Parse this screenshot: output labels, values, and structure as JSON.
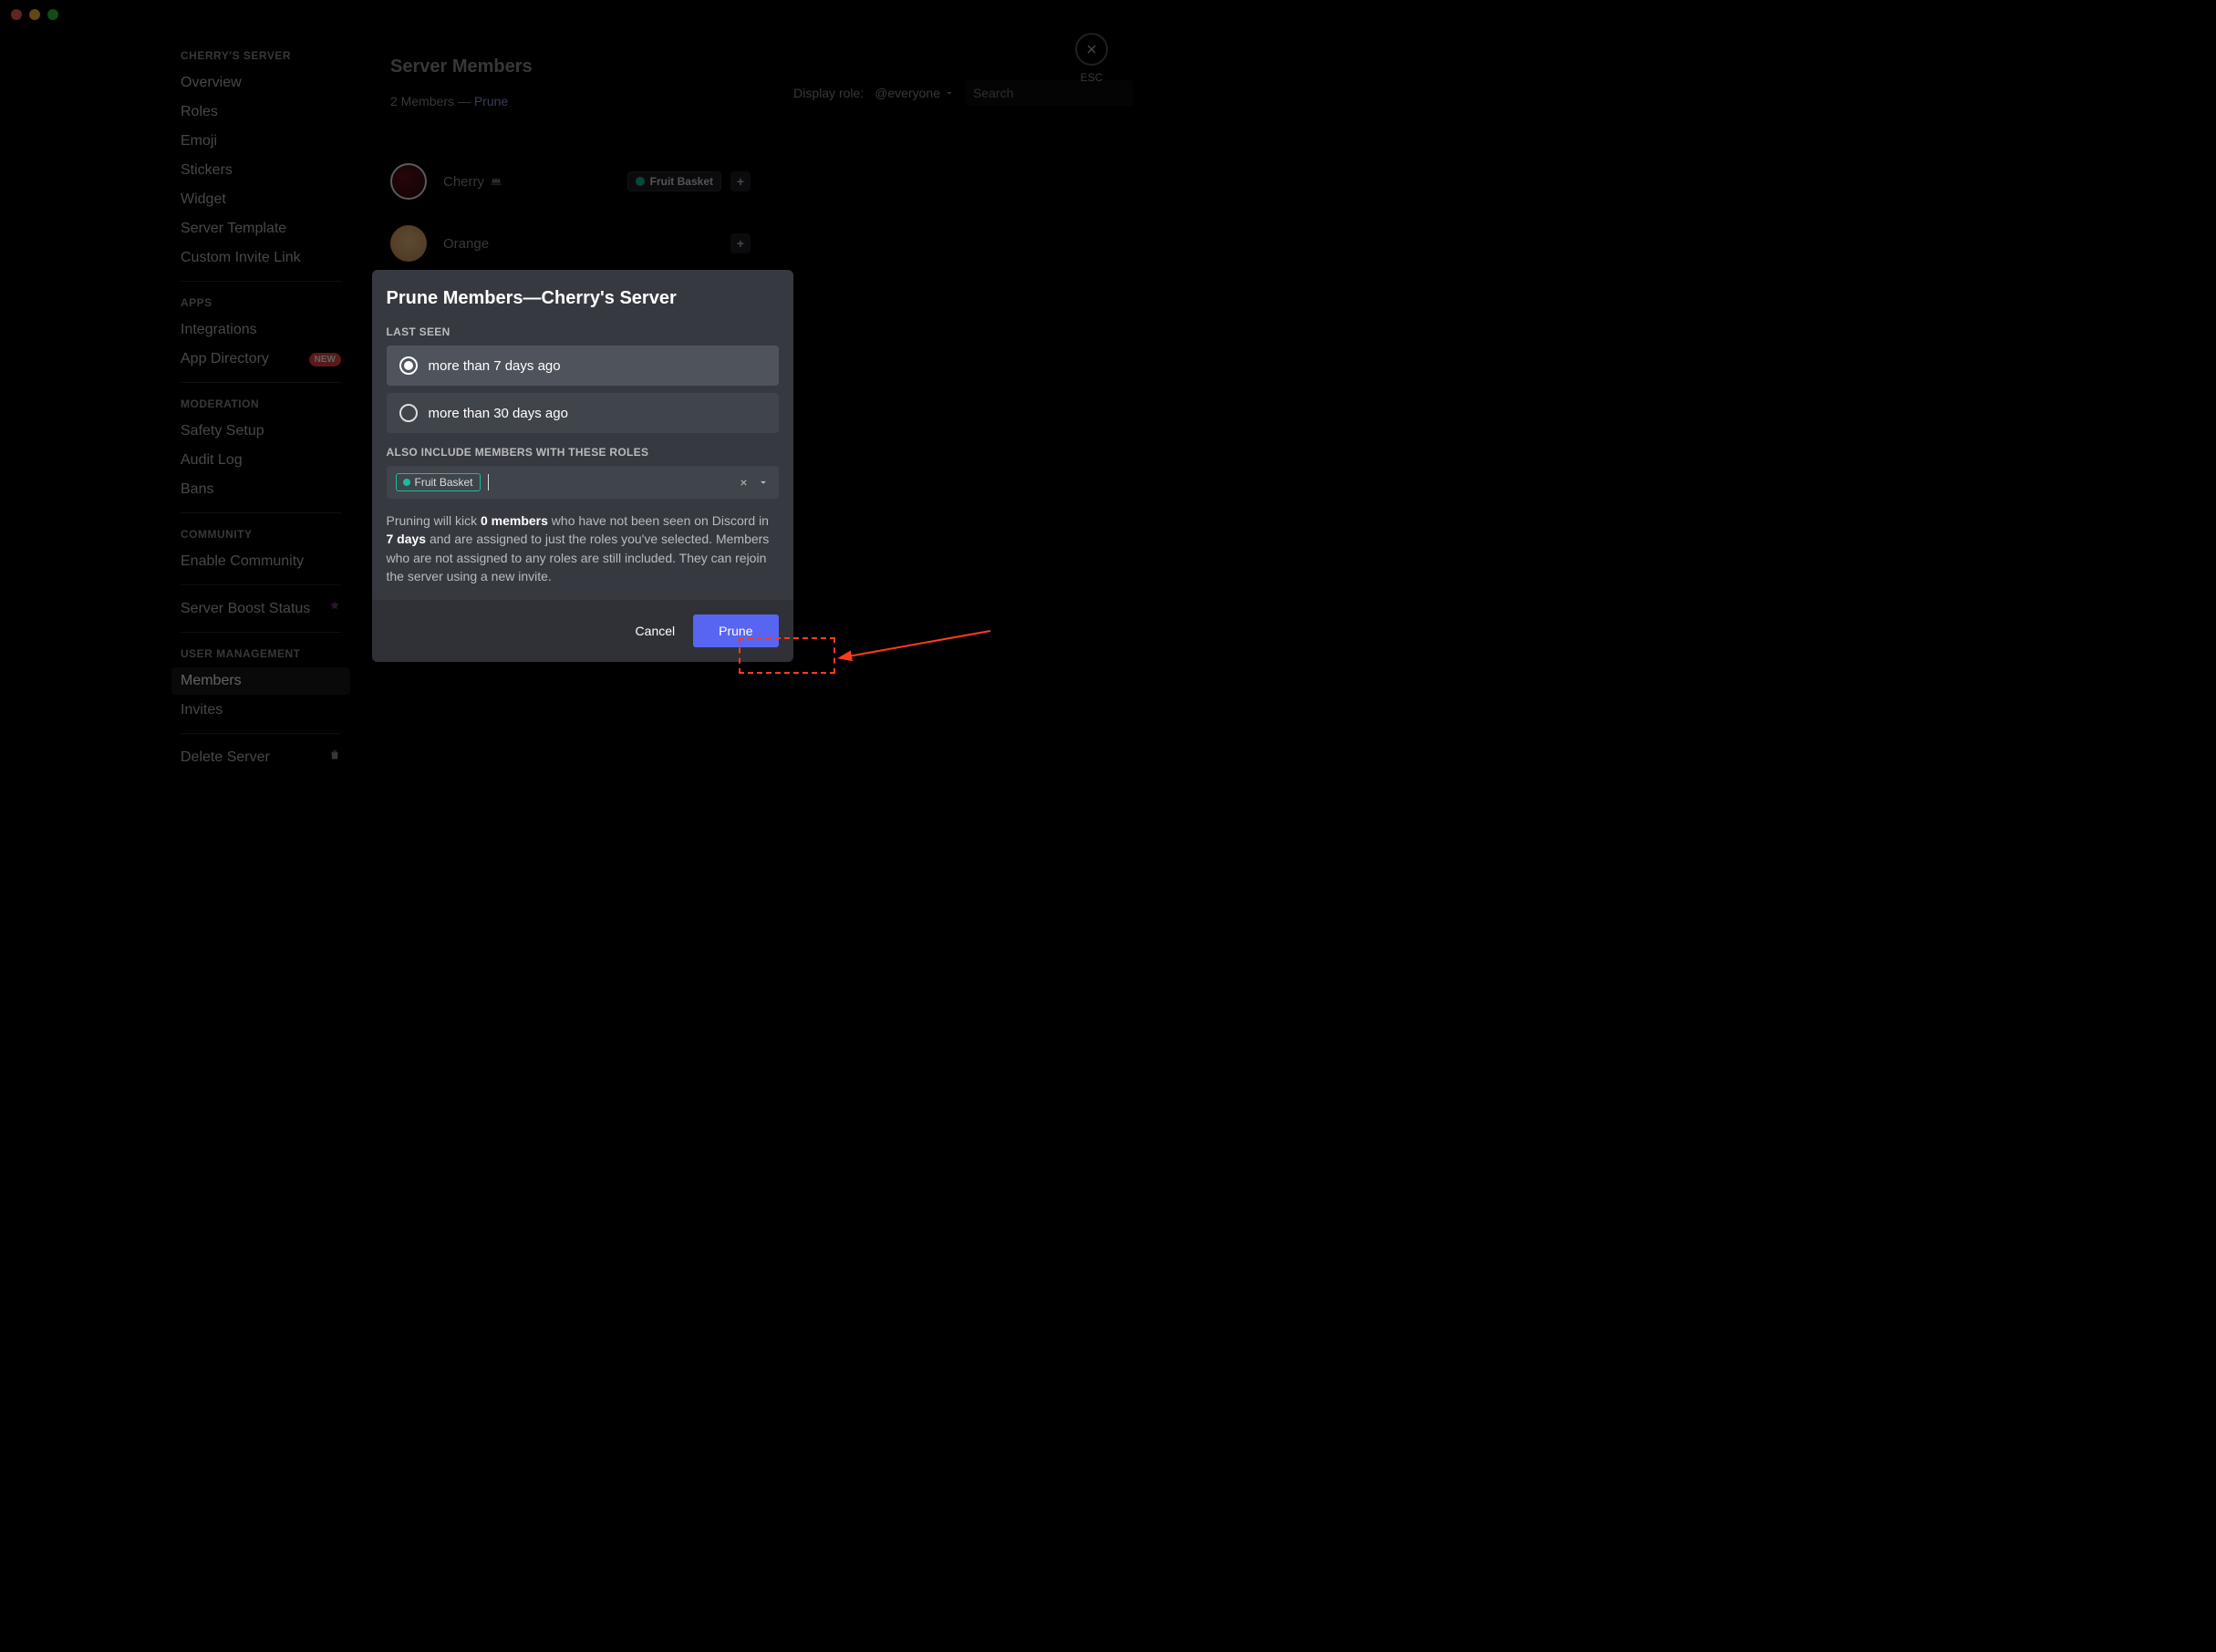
{
  "sidebar": {
    "server_label": "CHERRY'S SERVER",
    "items_general": [
      "Overview",
      "Roles",
      "Emoji",
      "Stickers",
      "Widget",
      "Server Template",
      "Custom Invite Link"
    ],
    "apps_label": "APPS",
    "items_apps": [
      "Integrations",
      "App Directory"
    ],
    "badge_new": "NEW",
    "moderation_label": "MODERATION",
    "items_moderation": [
      "Safety Setup",
      "Audit Log",
      "Bans"
    ],
    "community_label": "COMMUNITY",
    "items_community": [
      "Enable Community"
    ],
    "boost_label": "Server Boost Status",
    "user_mgmt_label": "USER MANAGEMENT",
    "items_user_mgmt": [
      "Members",
      "Invites"
    ],
    "delete_label": "Delete Server"
  },
  "page": {
    "title": "Server Members",
    "member_count_text": "2 Members —",
    "prune_link": "Prune",
    "display_role_label": "Display role:",
    "role_filter": "@everyone",
    "search_placeholder": "Search",
    "esc_label": "ESC"
  },
  "members": [
    {
      "name": "Cherry",
      "owner": true,
      "roles": [
        "Fruit Basket"
      ]
    },
    {
      "name": "Orange",
      "owner": false,
      "roles": []
    }
  ],
  "modal": {
    "title": "Prune Members—Cherry's Server",
    "last_seen_label": "LAST SEEN",
    "option_7": "more than 7 days ago",
    "option_30": "more than 30 days ago",
    "roles_label": "ALSO INCLUDE MEMBERS WITH THESE ROLES",
    "selected_role": "Fruit Basket",
    "desc_pre": "Pruning will kick ",
    "desc_count": "0 members",
    "desc_mid": " who have not been seen on Discord in ",
    "desc_days": "7 days",
    "desc_post": " and are assigned to just the roles you've selected. Members who are not assigned to any roles are still included. They can rejoin the server using a new invite.",
    "cancel": "Cancel",
    "prune": "Prune"
  },
  "colors": {
    "accent": "#5865f2",
    "role_green": "#1abc9c",
    "danger": "#ed4245"
  }
}
